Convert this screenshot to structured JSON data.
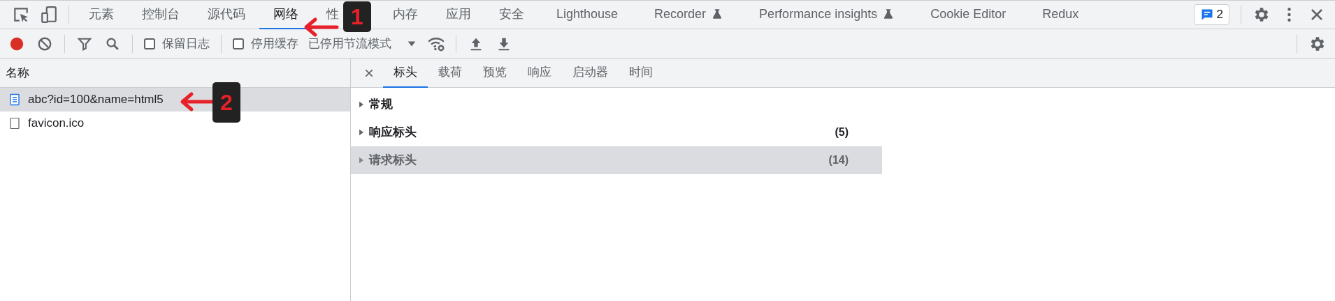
{
  "main_tabs": [
    {
      "label": "元素",
      "selected": false
    },
    {
      "label": "控制台",
      "selected": false
    },
    {
      "label": "源代码",
      "selected": false
    },
    {
      "label": "网络",
      "selected": true
    },
    {
      "label": "性",
      "selected": false
    },
    {
      "label": "内存",
      "selected": false
    },
    {
      "label": "应用",
      "selected": false
    },
    {
      "label": "安全",
      "selected": false
    },
    {
      "label": "Lighthouse",
      "selected": false,
      "experimental": false
    },
    {
      "label": "Recorder",
      "selected": false,
      "experimental": true
    },
    {
      "label": "Performance insights",
      "selected": false,
      "experimental": true
    },
    {
      "label": "Cookie Editor",
      "selected": false
    },
    {
      "label": "Redux",
      "selected": false
    }
  ],
  "issues_count": "2",
  "toolbar": {
    "recording": true,
    "preserve_log": {
      "label": "保留日志",
      "checked": false
    },
    "disable_cache": {
      "label": "停用缓存",
      "checked": false
    },
    "throttling": "已停用节流模式"
  },
  "requests": {
    "header": "名称",
    "rows": [
      {
        "name": "abc?id=100&name=html5",
        "kind": "document",
        "selected": true
      },
      {
        "name": "favicon.ico",
        "kind": "file",
        "selected": false
      }
    ]
  },
  "detail": {
    "tabs": [
      {
        "label": "标头",
        "selected": true
      },
      {
        "label": "载荷",
        "selected": false
      },
      {
        "label": "预览",
        "selected": false
      },
      {
        "label": "响应",
        "selected": false
      },
      {
        "label": "启动器",
        "selected": false
      },
      {
        "label": "时间",
        "selected": false
      }
    ],
    "sections": [
      {
        "title": "常规",
        "hovered": false
      },
      {
        "title": "响应标头",
        "count": "(5)",
        "hovered": false
      },
      {
        "title": "请求标头",
        "count": "(14)",
        "hovered": true
      }
    ]
  },
  "annotations": [
    {
      "number": "1"
    },
    {
      "number": "2"
    }
  ]
}
